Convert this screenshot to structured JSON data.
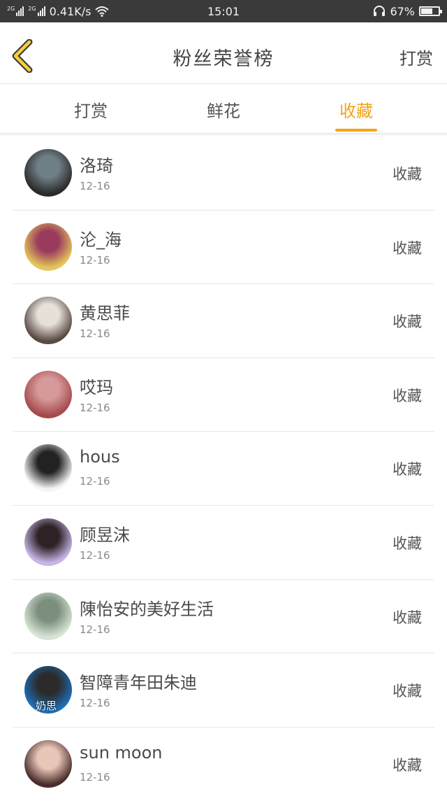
{
  "status_bar": {
    "net_tag_1": "2G",
    "net_tag_2": "2G",
    "speed": "0.41K/s",
    "clock": "15:01",
    "battery_text": "67%",
    "battery_level": 0.67
  },
  "nav": {
    "title": "粉丝荣誉榜",
    "right_action": "打赏",
    "back_icon": "chevron-left-icon"
  },
  "tabs": [
    {
      "label": "打赏",
      "active": false
    },
    {
      "label": "鲜花",
      "active": false
    },
    {
      "label": "收藏",
      "active": true
    }
  ],
  "colors": {
    "accent": "#f3a317",
    "status_bar_bg": "#3a3a3a"
  },
  "rows": [
    {
      "name": "洛琦",
      "date": "12-16",
      "action": "收藏",
      "avatar_colors": [
        "#2b2b2b",
        "#6f7f86"
      ]
    },
    {
      "name": "沦_海",
      "date": "12-16",
      "action": "收藏",
      "avatar_colors": [
        "#e5c65a",
        "#9a3b5e"
      ]
    },
    {
      "name": "黄思菲",
      "date": "12-16",
      "action": "收藏",
      "avatar_colors": [
        "#5a4a44",
        "#e6e0d8"
      ]
    },
    {
      "name": "哎玛",
      "date": "12-16",
      "action": "收藏",
      "avatar_colors": [
        "#a54a4e",
        "#d79a9a"
      ]
    },
    {
      "name": "hous",
      "date": "12-16",
      "action": "收藏",
      "avatar_colors": [
        "#f4f4f4",
        "#222222"
      ]
    },
    {
      "name": "顾昱沫",
      "date": "12-16",
      "action": "收藏",
      "avatar_colors": [
        "#c9b6e8",
        "#2d2326"
      ]
    },
    {
      "name": "陳怡安的美好生活",
      "date": "12-16",
      "action": "收藏",
      "avatar_colors": [
        "#d7e4d5",
        "#7c8f7d"
      ]
    },
    {
      "name": "智障青年田朱迪",
      "date": "12-16",
      "action": "收藏",
      "avatar_colors": [
        "#1d6fb8",
        "#2b2b2b"
      ],
      "avatar_label": "奶思"
    },
    {
      "name": "sun moon",
      "date": "12-16",
      "action": "收藏",
      "avatar_colors": [
        "#4a2c2a",
        "#e8c7b8"
      ]
    }
  ]
}
